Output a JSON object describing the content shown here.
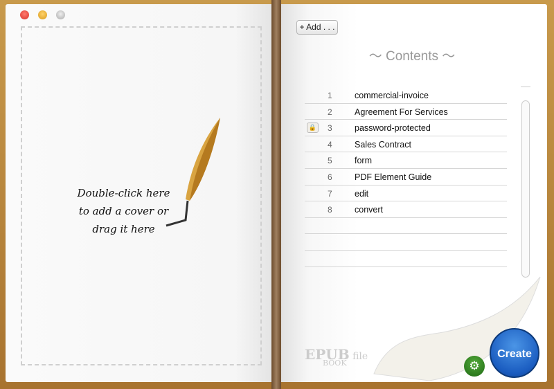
{
  "window": {
    "controls": [
      "close",
      "minimize",
      "zoom"
    ]
  },
  "left_page": {
    "cover_hint": [
      "Double-click here",
      "to add a cover or",
      "drag it here"
    ]
  },
  "right_page": {
    "add_button": "+ Add . . .",
    "contents_title": "Contents",
    "items": [
      {
        "num": "1",
        "name": "commercial-invoice",
        "locked": false
      },
      {
        "num": "2",
        "name": "Agreement For Services",
        "locked": false
      },
      {
        "num": "3",
        "name": "password-protected",
        "locked": true
      },
      {
        "num": "4",
        "name": "Sales Contract",
        "locked": false
      },
      {
        "num": "5",
        "name": "form",
        "locked": false
      },
      {
        "num": "6",
        "name": "PDF Element Guide",
        "locked": false
      },
      {
        "num": "7",
        "name": "edit",
        "locked": false
      },
      {
        "num": "8",
        "name": "convert",
        "locked": false
      }
    ],
    "create_button": "Create",
    "logo": "EPUB file BOOK"
  },
  "colors": {
    "create": "#1a5cc0",
    "settings": "#2f7d20",
    "frame": "#b9843c"
  }
}
